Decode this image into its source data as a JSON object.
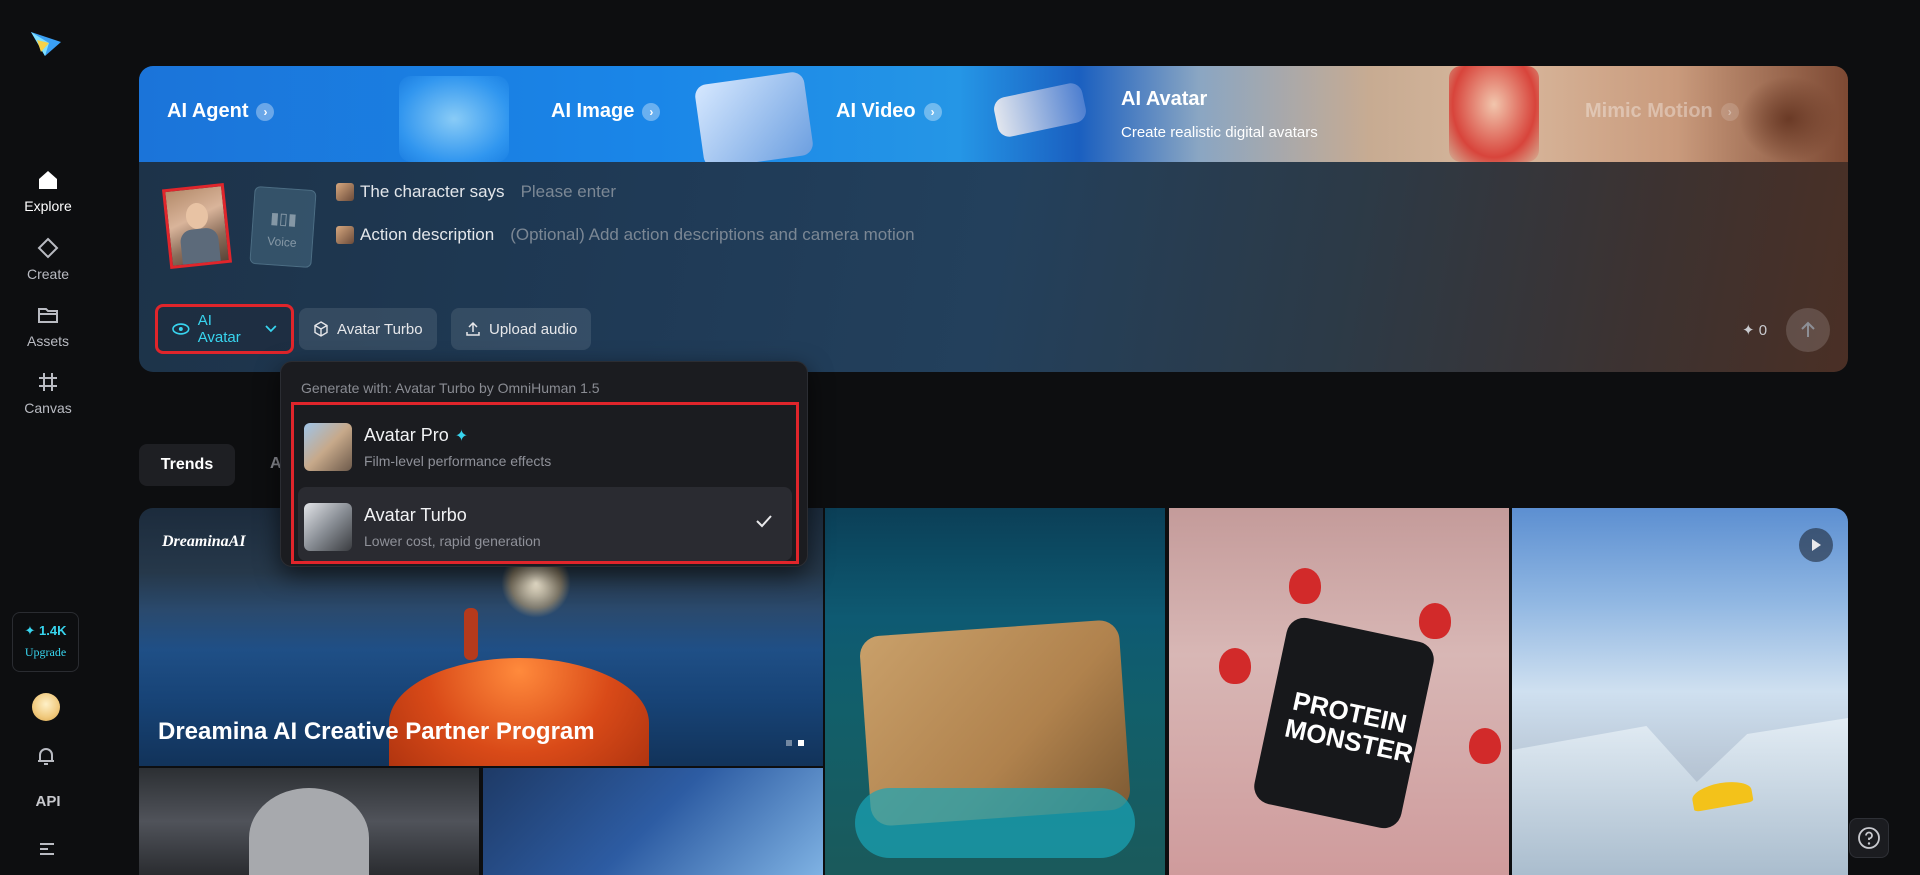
{
  "sidebar": {
    "items": [
      {
        "label": "Explore",
        "icon": "home-icon"
      },
      {
        "label": "Create",
        "icon": "diamond-icon"
      },
      {
        "label": "Assets",
        "icon": "folder-icon"
      },
      {
        "label": "Canvas",
        "icon": "canvas-icon"
      }
    ],
    "credits": "✦ 1.4K",
    "upgrade_label": "Upgrade",
    "api_label": "API"
  },
  "banner": {
    "tabs": [
      {
        "label": "AI Agent"
      },
      {
        "label": "AI Image"
      },
      {
        "label": "AI Video"
      },
      {
        "label": "AI Avatar",
        "description": "Create realistic digital avatars"
      },
      {
        "label": "Mimic Motion"
      }
    ]
  },
  "prompt": {
    "voice_label": "Voice",
    "character_says_label": "The character says",
    "character_says_placeholder": "Please enter",
    "action_label": "Action description",
    "action_placeholder": "(Optional) Add action descriptions and camera motion",
    "mode_button": "AI Avatar",
    "model_button": "Avatar Turbo",
    "upload_button": "Upload audio",
    "credit_cost": "✦ 0"
  },
  "dropdown": {
    "header": "Generate with: Avatar Turbo by OmniHuman 1.5",
    "options": [
      {
        "title": "Avatar Pro",
        "subtitle": "Film-level performance effects",
        "selected": false
      },
      {
        "title": "Avatar Turbo",
        "subtitle": "Lower cost, rapid generation",
        "selected": true
      }
    ]
  },
  "feed": {
    "tabs": [
      "Trends",
      "A"
    ],
    "hero_brand": "DreaminaAI",
    "hero_title": "Dreamina AI Creative Partner Program",
    "product_label": "PROTEIN MONSTER"
  },
  "colors": {
    "accent": "#38d5ef",
    "highlight_border": "#e0252b",
    "background": "#0d0e10"
  }
}
